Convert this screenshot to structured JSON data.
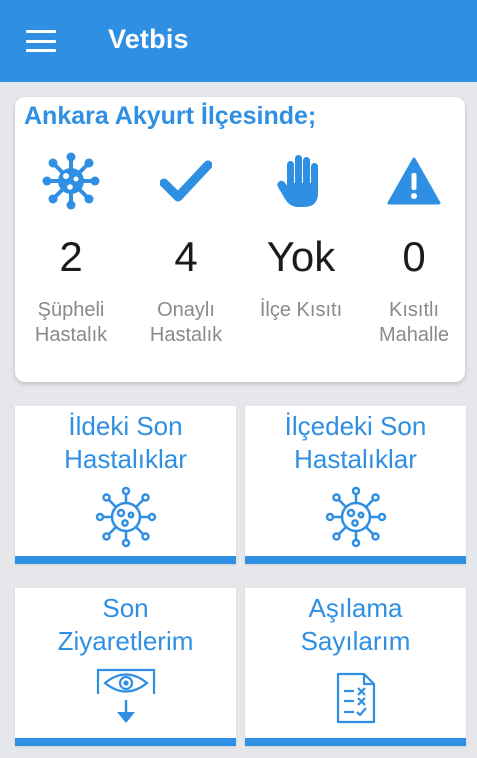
{
  "app": {
    "title": "Vetbis",
    "accent_color": "#2f8fe3"
  },
  "summary": {
    "title": "Ankara Akyurt İlçesinde;",
    "stats": [
      {
        "icon": "virus-icon",
        "value": "2",
        "label": "Şüpheli\nHastalık"
      },
      {
        "icon": "check-icon",
        "value": "4",
        "label": "Onaylı\nHastalık"
      },
      {
        "icon": "hand-stop-icon",
        "value": "Yok",
        "label": "İlçe Kısıtı"
      },
      {
        "icon": "warning-icon",
        "value": "0",
        "label": "Kısıtlı\nMahalle"
      }
    ]
  },
  "tiles": [
    {
      "label": "İldeki Son\nHastalıklar",
      "icon": "virus-outline-icon"
    },
    {
      "label": "İlçedeki Son\nHastalıklar",
      "icon": "virus-outline-icon"
    },
    {
      "label": "Son\nZiyaretlerim",
      "icon": "eye-inspection-icon"
    },
    {
      "label": "Aşılama\nSayılarım",
      "icon": "checklist-document-icon"
    }
  ]
}
